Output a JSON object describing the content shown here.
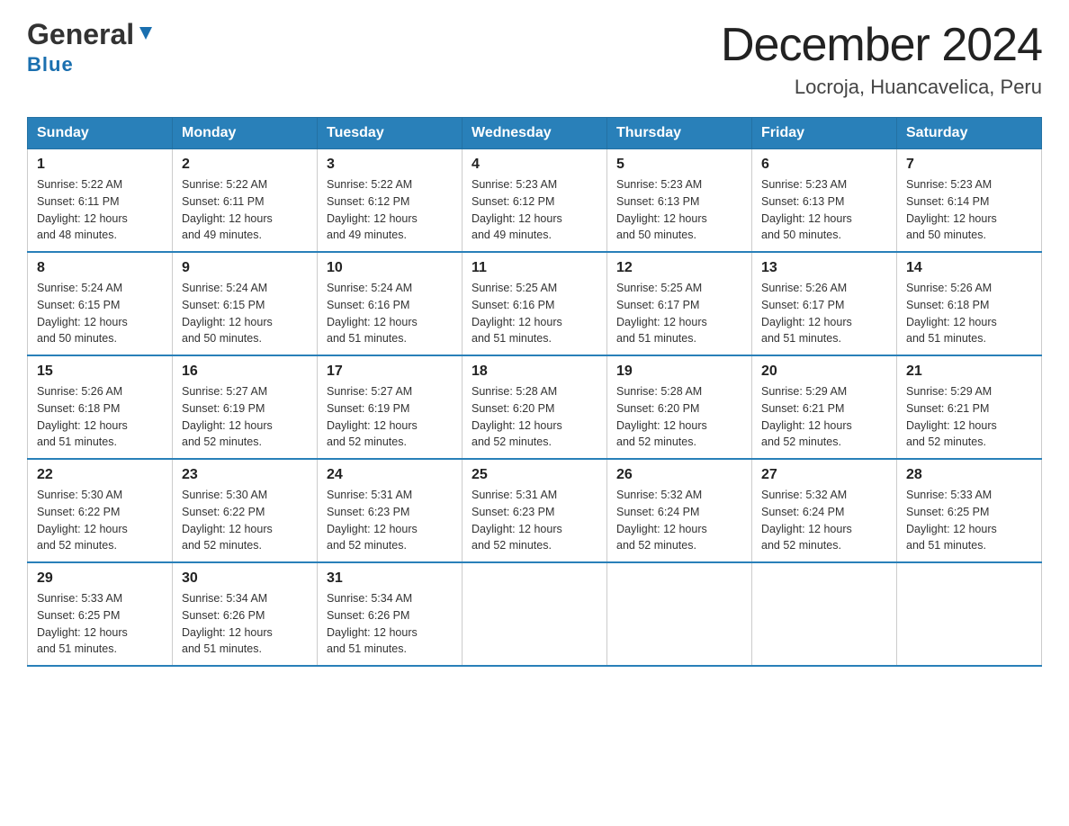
{
  "header": {
    "logo_line1": "General",
    "logo_line2": "Blue",
    "calendar_title": "December 2024",
    "calendar_subtitle": "Locroja, Huancavelica, Peru"
  },
  "days_of_week": [
    "Sunday",
    "Monday",
    "Tuesday",
    "Wednesday",
    "Thursday",
    "Friday",
    "Saturday"
  ],
  "weeks": [
    [
      {
        "day": "1",
        "sunrise": "5:22 AM",
        "sunset": "6:11 PM",
        "daylight": "12 hours and 48 minutes."
      },
      {
        "day": "2",
        "sunrise": "5:22 AM",
        "sunset": "6:11 PM",
        "daylight": "12 hours and 49 minutes."
      },
      {
        "day": "3",
        "sunrise": "5:22 AM",
        "sunset": "6:12 PM",
        "daylight": "12 hours and 49 minutes."
      },
      {
        "day": "4",
        "sunrise": "5:23 AM",
        "sunset": "6:12 PM",
        "daylight": "12 hours and 49 minutes."
      },
      {
        "day": "5",
        "sunrise": "5:23 AM",
        "sunset": "6:13 PM",
        "daylight": "12 hours and 50 minutes."
      },
      {
        "day": "6",
        "sunrise": "5:23 AM",
        "sunset": "6:13 PM",
        "daylight": "12 hours and 50 minutes."
      },
      {
        "day": "7",
        "sunrise": "5:23 AM",
        "sunset": "6:14 PM",
        "daylight": "12 hours and 50 minutes."
      }
    ],
    [
      {
        "day": "8",
        "sunrise": "5:24 AM",
        "sunset": "6:15 PM",
        "daylight": "12 hours and 50 minutes."
      },
      {
        "day": "9",
        "sunrise": "5:24 AM",
        "sunset": "6:15 PM",
        "daylight": "12 hours and 50 minutes."
      },
      {
        "day": "10",
        "sunrise": "5:24 AM",
        "sunset": "6:16 PM",
        "daylight": "12 hours and 51 minutes."
      },
      {
        "day": "11",
        "sunrise": "5:25 AM",
        "sunset": "6:16 PM",
        "daylight": "12 hours and 51 minutes."
      },
      {
        "day": "12",
        "sunrise": "5:25 AM",
        "sunset": "6:17 PM",
        "daylight": "12 hours and 51 minutes."
      },
      {
        "day": "13",
        "sunrise": "5:26 AM",
        "sunset": "6:17 PM",
        "daylight": "12 hours and 51 minutes."
      },
      {
        "day": "14",
        "sunrise": "5:26 AM",
        "sunset": "6:18 PM",
        "daylight": "12 hours and 51 minutes."
      }
    ],
    [
      {
        "day": "15",
        "sunrise": "5:26 AM",
        "sunset": "6:18 PM",
        "daylight": "12 hours and 51 minutes."
      },
      {
        "day": "16",
        "sunrise": "5:27 AM",
        "sunset": "6:19 PM",
        "daylight": "12 hours and 52 minutes."
      },
      {
        "day": "17",
        "sunrise": "5:27 AM",
        "sunset": "6:19 PM",
        "daylight": "12 hours and 52 minutes."
      },
      {
        "day": "18",
        "sunrise": "5:28 AM",
        "sunset": "6:20 PM",
        "daylight": "12 hours and 52 minutes."
      },
      {
        "day": "19",
        "sunrise": "5:28 AM",
        "sunset": "6:20 PM",
        "daylight": "12 hours and 52 minutes."
      },
      {
        "day": "20",
        "sunrise": "5:29 AM",
        "sunset": "6:21 PM",
        "daylight": "12 hours and 52 minutes."
      },
      {
        "day": "21",
        "sunrise": "5:29 AM",
        "sunset": "6:21 PM",
        "daylight": "12 hours and 52 minutes."
      }
    ],
    [
      {
        "day": "22",
        "sunrise": "5:30 AM",
        "sunset": "6:22 PM",
        "daylight": "12 hours and 52 minutes."
      },
      {
        "day": "23",
        "sunrise": "5:30 AM",
        "sunset": "6:22 PM",
        "daylight": "12 hours and 52 minutes."
      },
      {
        "day": "24",
        "sunrise": "5:31 AM",
        "sunset": "6:23 PM",
        "daylight": "12 hours and 52 minutes."
      },
      {
        "day": "25",
        "sunrise": "5:31 AM",
        "sunset": "6:23 PM",
        "daylight": "12 hours and 52 minutes."
      },
      {
        "day": "26",
        "sunrise": "5:32 AM",
        "sunset": "6:24 PM",
        "daylight": "12 hours and 52 minutes."
      },
      {
        "day": "27",
        "sunrise": "5:32 AM",
        "sunset": "6:24 PM",
        "daylight": "12 hours and 52 minutes."
      },
      {
        "day": "28",
        "sunrise": "5:33 AM",
        "sunset": "6:25 PM",
        "daylight": "12 hours and 51 minutes."
      }
    ],
    [
      {
        "day": "29",
        "sunrise": "5:33 AM",
        "sunset": "6:25 PM",
        "daylight": "12 hours and 51 minutes."
      },
      {
        "day": "30",
        "sunrise": "5:34 AM",
        "sunset": "6:26 PM",
        "daylight": "12 hours and 51 minutes."
      },
      {
        "day": "31",
        "sunrise": "5:34 AM",
        "sunset": "6:26 PM",
        "daylight": "12 hours and 51 minutes."
      },
      null,
      null,
      null,
      null
    ]
  ],
  "labels": {
    "sunrise_prefix": "Sunrise: ",
    "sunset_prefix": "Sunset: ",
    "daylight_prefix": "Daylight: "
  }
}
